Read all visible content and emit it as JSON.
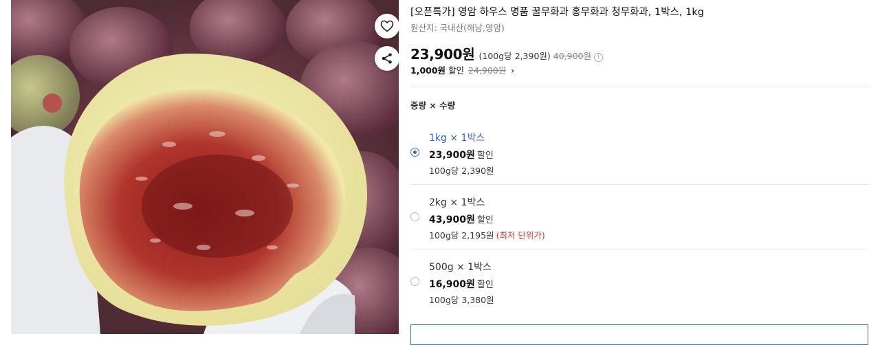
{
  "product": {
    "title": "[오픈특가] 영암 하우스 명품 꿀무화과 홍무화과 청무화과, 1박스, 1kg",
    "origin": "원산지: 국내산(해남,영암)",
    "price": "23,900원",
    "unit_price": "(100g당 2,390원)",
    "original_price": "40,900원",
    "info_icon": "info-icon",
    "discount_amount": "1,000원",
    "discount_label": "할인",
    "discount_original": "24,900원",
    "discount_chevron": "›"
  },
  "image": {
    "alt_subject": "cut fig",
    "wishlist_icon": "heart-icon",
    "share_icon": "share-icon"
  },
  "options": {
    "label": "중량 × 수량",
    "items": [
      {
        "name": "1kg × 1박스",
        "price": "23,900원",
        "discount_word": "할인",
        "unit": "100g당 2,390원",
        "badge": "",
        "selected": true
      },
      {
        "name": "2kg × 1박스",
        "price": "43,900원",
        "discount_word": "할인",
        "unit": "100g당 2,195원",
        "badge": "(최저 단위가)",
        "selected": false
      },
      {
        "name": "500g × 1박스",
        "price": "16,900원",
        "discount_word": "할인",
        "unit": "100g당 3,380원",
        "badge": "",
        "selected": false
      }
    ]
  },
  "colors": {
    "accent": "#2f63d6",
    "best_price": "#e0332d",
    "strike": "#888888"
  }
}
